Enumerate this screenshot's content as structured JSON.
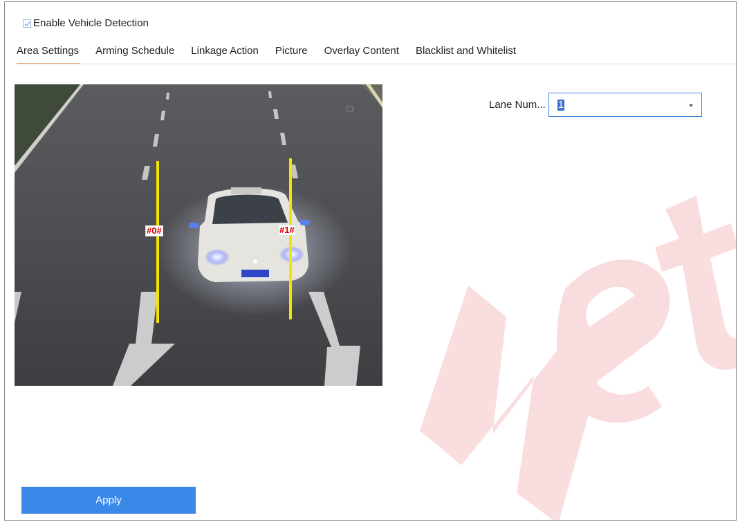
{
  "enable": {
    "label": "Enable Vehicle Detection",
    "checked": true
  },
  "tabs": [
    {
      "label": "Area Settings",
      "active": true
    },
    {
      "label": "Arming Schedule"
    },
    {
      "label": "Linkage Action"
    },
    {
      "label": "Picture"
    },
    {
      "label": "Overlay Content"
    },
    {
      "label": "Blacklist and Whitelist"
    }
  ],
  "video": {
    "lanes": [
      {
        "label": "#0#"
      },
      {
        "label": "#1#"
      }
    ]
  },
  "lane_number": {
    "label": "Lane Num...",
    "value": "1"
  },
  "apply_label": "Apply",
  "colors": {
    "accent": "#3a89e8",
    "tab_underline": "#e9a86a",
    "lane_line": "#f2e600",
    "watermark": "#d9000a"
  }
}
